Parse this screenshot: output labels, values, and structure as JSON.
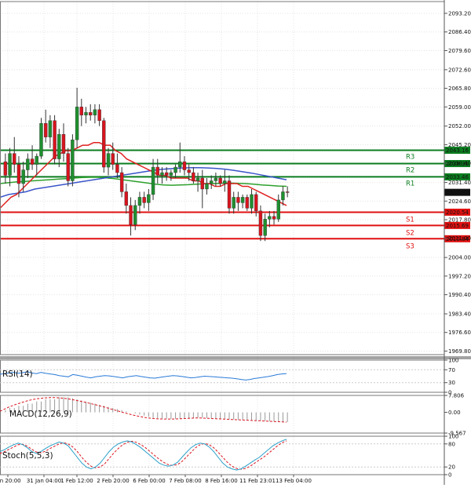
{
  "chart_data": {
    "type": "candlestick",
    "x_labels": [
      "Jan 20:00",
      "31 Jan 04:00",
      "1 Feb 12:00",
      "2 Feb 20:00",
      "6 Feb 00:00",
      "7 Feb 08:00",
      "8 Feb 16:00",
      "11 Feb 23:01",
      "13 Feb 04:00"
    ],
    "y_ticks": [
      "2093.20",
      "2086.40",
      "2079.60",
      "2072.60",
      "2065.80",
      "2059.00",
      "2052.00",
      "2045.20",
      "2038.40",
      "2031.40",
      "2024.60",
      "2017.80",
      "2011.00",
      "2004.00",
      "1997.20",
      "1990.40",
      "1983.40",
      "1976.60",
      "1969.80"
    ],
    "ylim": [
      1968.5,
      2097.5
    ],
    "levels": [
      {
        "name": "R3",
        "value": 2043.16,
        "label": "2043.16",
        "color": "#0b7d1f"
      },
      {
        "name": "R2",
        "value": 2038.31,
        "label": "2038.31",
        "color": "#0b7d1f"
      },
      {
        "name": "R1",
        "value": 2033.46,
        "label": "2033.46",
        "color": "#0b7d1f"
      },
      {
        "name": "S1",
        "value": 2020.54,
        "label": "2020.54",
        "color": "#e01010"
      },
      {
        "name": "S2",
        "value": 2015.69,
        "label": "2015.69",
        "color": "#e01010"
      },
      {
        "name": "S3",
        "value": 2010.84,
        "label": "2010.84",
        "color": "#e01010"
      }
    ],
    "current_price": {
      "value": 2027.8,
      "label": "2027.80"
    },
    "candles": [
      [
        2039,
        2042,
        2031,
        2034
      ],
      [
        2034,
        2044,
        2030,
        2042
      ],
      [
        2042,
        2048,
        2035,
        2038
      ],
      [
        2038,
        2041,
        2026,
        2031
      ],
      [
        2031,
        2039,
        2028,
        2036
      ],
      [
        2036,
        2042,
        2033,
        2040
      ],
      [
        2040,
        2045,
        2036,
        2038
      ],
      [
        2038,
        2042,
        2034,
        2041
      ],
      [
        2041,
        2055,
        2040,
        2053
      ],
      [
        2053,
        2058,
        2046,
        2048
      ],
      [
        2048,
        2056,
        2044,
        2054
      ],
      [
        2054,
        2056,
        2038,
        2040
      ],
      [
        2040,
        2051,
        2037,
        2049
      ],
      [
        2049,
        2053,
        2039,
        2042
      ],
      [
        2042,
        2044,
        2030,
        2032
      ],
      [
        2032,
        2049,
        2030,
        2047
      ],
      [
        2047,
        2066,
        2044,
        2059
      ],
      [
        2059,
        2062,
        2052,
        2056
      ],
      [
        2056,
        2059,
        2053,
        2057
      ],
      [
        2057,
        2060,
        2054,
        2056
      ],
      [
        2056,
        2060,
        2053,
        2058
      ],
      [
        2058,
        2060,
        2052,
        2054
      ],
      [
        2054,
        2055,
        2035,
        2037
      ],
      [
        2037,
        2044,
        2034,
        2042
      ],
      [
        2042,
        2046,
        2036,
        2038
      ],
      [
        2038,
        2042,
        2033,
        2035
      ],
      [
        2035,
        2037,
        2026,
        2028
      ],
      [
        2028,
        2031,
        2020,
        2023
      ],
      [
        2023,
        2026,
        2012,
        2016
      ],
      [
        2016,
        2025,
        2014,
        2023
      ],
      [
        2023,
        2028,
        2020,
        2026
      ],
      [
        2026,
        2028,
        2022,
        2024
      ],
      [
        2024,
        2029,
        2021,
        2027
      ],
      [
        2027,
        2040,
        2025,
        2037
      ],
      [
        2037,
        2040,
        2031,
        2034
      ],
      [
        2034,
        2037,
        2031,
        2035
      ],
      [
        2035,
        2037,
        2032,
        2034
      ],
      [
        2034,
        2036,
        2032,
        2035
      ],
      [
        2035,
        2038,
        2033,
        2037
      ],
      [
        2037,
        2046,
        2035,
        2039
      ],
      [
        2039,
        2041,
        2034,
        2036
      ],
      [
        2036,
        2038,
        2032,
        2035
      ],
      [
        2035,
        2037,
        2031,
        2032
      ],
      [
        2032,
        2035,
        2028,
        2033
      ],
      [
        2033,
        2036,
        2022,
        2029
      ],
      [
        2029,
        2033,
        2027,
        2031
      ],
      [
        2031,
        2034,
        2029,
        2032
      ],
      [
        2032,
        2035,
        2030,
        2033
      ],
      [
        2033,
        2034,
        2030,
        2031
      ],
      [
        2031,
        2036,
        2028,
        2032
      ],
      [
        2032,
        2034,
        2020,
        2022
      ],
      [
        2022,
        2028,
        2020,
        2026
      ],
      [
        2026,
        2028,
        2021,
        2024
      ],
      [
        2024,
        2027,
        2022,
        2026
      ],
      [
        2026,
        2027,
        2021,
        2022
      ],
      [
        2022,
        2029,
        2020,
        2027
      ],
      [
        2027,
        2028,
        2019,
        2021
      ],
      [
        2021,
        2023,
        2010,
        2012
      ],
      [
        2012,
        2020,
        2010,
        2018
      ],
      [
        2018,
        2021,
        2015,
        2019
      ],
      [
        2019,
        2021,
        2016,
        2018
      ],
      [
        2018,
        2027,
        2017,
        2025
      ],
      [
        2025,
        2030,
        2023,
        2028
      ],
      [
        2028,
        2030,
        2026,
        2027.8
      ]
    ],
    "ma_red": [
      2022,
      2024,
      2026,
      2027,
      2029,
      2031,
      2033,
      2035,
      2037,
      2039,
      2041,
      2042,
      2043,
      2043,
      2044,
      2045,
      2045,
      2046,
      2046,
      2045,
      2045,
      2043,
      2042,
      2040,
      2039,
      2038,
      2037,
      2036,
      2035,
      2034,
      2034,
      2033,
      2033,
      2033,
      2033,
      2032,
      2032,
      2031,
      2031,
      2030,
      2030,
      2031,
      2031,
      2031,
      2030,
      2030,
      2029,
      2028,
      2027,
      2026,
      2025,
      2024,
      2023
    ],
    "ma_blue": [
      2026,
      2027,
      2027.5,
      2028,
      2029,
      2029.5,
      2030,
      2030.5,
      2031,
      2031.5,
      2032,
      2032.5,
      2033,
      2033.5,
      2034,
      2034.5,
      2035,
      2035.5,
      2036,
      2036.3,
      2036.5,
      2036.7,
      2036.8,
      2036.8,
      2036.7,
      2036.5,
      2036.2,
      2035.8,
      2035.3,
      2034.8,
      2034.2,
      2033.6,
      2033,
      2032.4
    ],
    "ma_green": [
      2031,
      2031.3,
      2031.6,
      2031.8,
      2032,
      2032.2,
      2032.4,
      2032.6,
      2032.8,
      2033,
      2033.2,
      2033.3,
      2033.3,
      2033.1,
      2032.8,
      2032.4,
      2032,
      2031.6,
      2031.2,
      2030.8,
      2030.5,
      2030.4,
      2030.5,
      2030.6,
      2030.8,
      2030.9,
      2031,
      2031.1,
      2031.2,
      2031.1,
      2031,
      2030.8,
      2030.5,
      2030.3,
      2030.1,
      2030
    ],
    "rsi": {
      "title": "RSI(14)",
      "ticks": [
        "100",
        "70",
        "30",
        "0"
      ],
      "values": [
        56,
        58,
        60,
        62,
        59,
        61,
        64,
        60,
        58,
        62,
        59,
        57,
        55,
        52,
        50,
        48,
        55,
        53,
        50,
        47,
        45,
        48,
        50,
        52,
        51,
        49,
        47,
        45,
        48,
        50,
        52,
        49,
        47,
        45,
        44,
        46,
        48,
        50,
        52,
        51,
        49,
        47,
        45,
        46,
        48,
        50,
        49,
        48,
        47,
        46,
        45,
        44,
        42,
        40,
        38,
        40,
        43,
        45,
        47,
        49,
        52,
        55,
        57,
        58
      ]
    },
    "macd": {
      "title": "MACD(12,26,9)",
      "ticks": [
        "7.806",
        "0.00",
        "-9.567"
      ],
      "hist": [
        1,
        2,
        2,
        3,
        3,
        4,
        4,
        5,
        5,
        6,
        6,
        6,
        7,
        7,
        7,
        6.5,
        6,
        5.5,
        5,
        4.5,
        4,
        3.5,
        3,
        2.5,
        2,
        1.5,
        1,
        0.5,
        0,
        -0.5,
        -1,
        -1.5,
        -2,
        -2.5,
        -2.7,
        -2.8,
        -2.9,
        -3,
        -3,
        -2.9,
        -2.8,
        -2.7,
        -2.6,
        -2.5,
        -2.5,
        -2.6,
        -2.7,
        -2.9,
        -3,
        -3.1,
        -3.2,
        -3.3,
        -3.4,
        -3.5,
        -3.6,
        -3.7,
        -3.8,
        -3.9,
        -4,
        -4.1,
        -4.2,
        -4.3,
        -4.4,
        -4.5
      ],
      "signal": [
        0.5,
        1.5,
        2.5,
        3.3,
        4,
        4.7,
        5.3,
        5.8,
        6.2,
        6.5,
        6.7,
        6.8,
        6.8,
        6.7,
        6.5,
        6.2,
        5.8,
        5.4,
        5,
        4.5,
        4,
        3.5,
        3,
        2.4,
        1.8,
        1.2,
        0.6,
        0,
        -0.6,
        -1.1,
        -1.6,
        -2,
        -2.4,
        -2.7,
        -2.9,
        -3,
        -3.1,
        -3.1,
        -3.1,
        -3,
        -2.9,
        -2.8,
        -2.7,
        -2.6,
        -2.6,
        -2.7,
        -2.8,
        -2.9,
        -3,
        -3.1,
        -3.2,
        -3.3,
        -3.4,
        -3.5,
        -3.6,
        -3.7,
        -3.8,
        -3.9,
        -4,
        -4.1,
        -4.2,
        -4.3,
        -4.4,
        -4.5
      ]
    },
    "stoch": {
      "title": "Stoch(5,5,3)",
      "ticks_left": [
        "100",
        "80",
        "20",
        "0"
      ],
      "k": [
        60,
        65,
        72,
        78,
        82,
        78,
        70,
        60,
        55,
        60,
        68,
        75,
        80,
        85,
        82,
        75,
        60,
        45,
        30,
        20,
        15,
        20,
        30,
        45,
        60,
        72,
        80,
        85,
        88,
        85,
        78,
        70,
        60,
        50,
        40,
        30,
        25,
        22,
        25,
        32,
        45,
        58,
        70,
        78,
        82,
        80,
        72,
        60,
        45,
        30,
        20,
        15,
        12,
        15,
        22,
        30,
        38,
        45,
        55,
        65,
        75,
        82,
        88,
        92
      ],
      "d": [
        55,
        60,
        66,
        72,
        78,
        79,
        74,
        66,
        59,
        57,
        61,
        68,
        74,
        80,
        83,
        80,
        72,
        60,
        45,
        32,
        22,
        18,
        20,
        28,
        42,
        56,
        68,
        78,
        84,
        87,
        84,
        78,
        70,
        60,
        50,
        40,
        32,
        26,
        24,
        26,
        34,
        46,
        58,
        70,
        78,
        81,
        78,
        70,
        58,
        45,
        32,
        22,
        16,
        14,
        16,
        22,
        30,
        38,
        46,
        55,
        65,
        75,
        83,
        88
      ]
    }
  }
}
